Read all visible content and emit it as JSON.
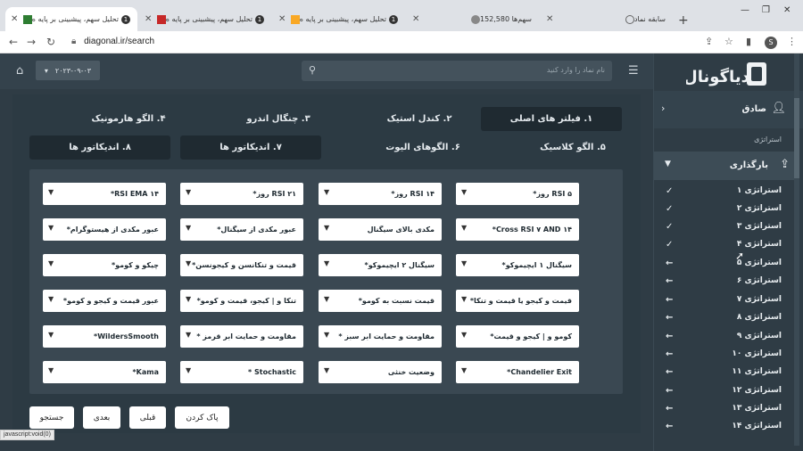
{
  "browser": {
    "tabs": [
      {
        "title": "تحلیل سهم، پیشبینی بر پایه ه",
        "count": "1"
      },
      {
        "title": "تحلیل سهم، پیشبینی بر پایه ه",
        "count": "1"
      },
      {
        "title": "تحلیل سهم، پیشبینی بر پایه ه",
        "count": "1"
      },
      {
        "title": "سهم‌ها 152,580"
      },
      {
        "title": "سابقه نماد"
      }
    ],
    "url": "diagonal.ir/search",
    "profile_initial": "S",
    "status_text": "javascript:void(0)"
  },
  "header": {
    "date": "۲۰۲۳-۰۹-۰۳",
    "search_placeholder": "نام نماد را وارد کنید"
  },
  "categories": [
    "۱. فیلتر های اصلی",
    "۲. کندل استیک",
    "۳. چنگال اندرو",
    "۴. الگو هارمونیک",
    "۵. الگو کلاسیک",
    "۶. الگوهای الیوت",
    "۷. اندیکاتور ها",
    "۸. اندیکاتور ها"
  ],
  "filters": [
    [
      "RSI ۵ روز*",
      "RSI ۱۴ روز*",
      "RSI ۲۱ روز*",
      "RSI EMA ۱۴*"
    ],
    [
      "Cross RSI ۷ AND ۱۴*",
      "مکدی بالای سیگنال",
      "عبور مکدی از سیگنال*",
      "عبور مکدی از هیستوگرام*"
    ],
    [
      "سیگنال ۱ ایچیموکو*",
      "سیگنال ۲ ایچیموکو*",
      "قیمت و تنکانسن و کیجونسن*",
      "چیکو و کومو*"
    ],
    [
      "قیمت و کیجو یا قیمت و تنکا*",
      "قیمت نسبت به کومو*",
      "تنکا و | کیجو، قیمت و کومو*",
      "عبور قیمت و کیجو و کومو*"
    ],
    [
      "کومو و | کیجو و قیمت*",
      "مقاومت و حمایت ابر سبز *",
      "مقاومت و حمایت ابر قرمز *",
      "WildersSmooth*"
    ],
    [
      "Chandelier Exit*",
      "وضعیت خنثی",
      "Stochastic *",
      "Kama*"
    ]
  ],
  "buttons": {
    "clear": "پاک کردن",
    "prev": "قبلی",
    "next": "بعدی",
    "search": "جستجو"
  },
  "sidebar": {
    "logo_text": "دیاگونال",
    "user_name": "صادق",
    "section_label": "استراتژی",
    "upload_label": "بارگذاری",
    "strategies": [
      {
        "label": "استراتژی ۱",
        "icon": "check"
      },
      {
        "label": "استراتژی ۲",
        "icon": "check"
      },
      {
        "label": "استراتژی ۳",
        "icon": "check"
      },
      {
        "label": "استراتژی ۴",
        "icon": "check"
      },
      {
        "label": "استراتژی ۵",
        "icon": "arrow-left"
      },
      {
        "label": "استراتژی ۶",
        "icon": "arrow-left"
      },
      {
        "label": "استراتژی ۷",
        "icon": "arrow-left"
      },
      {
        "label": "استراتژی ۸",
        "icon": "arrow-left"
      },
      {
        "label": "استراتژی ۹",
        "icon": "arrow-left"
      },
      {
        "label": "استراتژی ۱۰",
        "icon": "arrow-left"
      },
      {
        "label": "استراتژی ۱۱",
        "icon": "arrow-left"
      },
      {
        "label": "استراتژی ۱۲",
        "icon": "arrow-left"
      },
      {
        "label": "استراتژی ۱۳",
        "icon": "arrow-left"
      },
      {
        "label": "استراتژی ۱۴",
        "icon": "arrow-left"
      }
    ]
  },
  "colors": {
    "background": "#2f3c45",
    "panel": "#2c3a43",
    "filter_box": "#3a4852",
    "dropdown": "#ffffff",
    "accent_dark": "#1f2a31"
  }
}
